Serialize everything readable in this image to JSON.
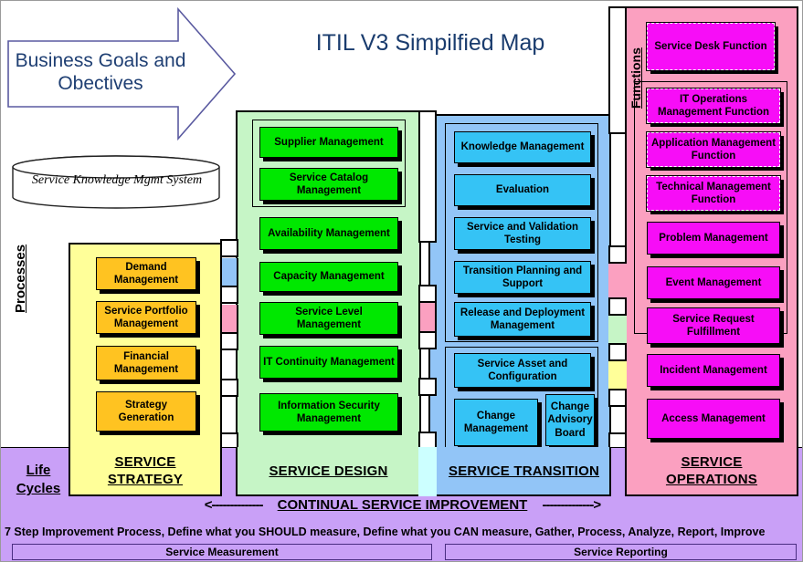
{
  "title": "ITIL V3 Simpilfied Map",
  "goals": {
    "text_line1": "Business Goals and",
    "text_line2": "Obectives",
    "icon": "right-arrow-banner"
  },
  "skms": {
    "label": "Service Knowledge Mgmt  System",
    "icon": "database-cylinder-icon"
  },
  "side_labels": {
    "processes": "Processes",
    "functions": "Functions",
    "life_cycles_line1": "Life ",
    "life_cycles_line2": "Cycles"
  },
  "columns": [
    {
      "key": "strategy",
      "title_line1": "SERVICE ",
      "title_line2": "STRATEGY",
      "color": "#ffff99",
      "box_color": "#ffc321",
      "items": [
        {
          "label": "Demand Management"
        },
        {
          "label": "Service Portfolio Management"
        },
        {
          "label": "Financial Management"
        },
        {
          "label": "Strategy Generation"
        }
      ]
    },
    {
      "key": "design",
      "title_line1": "SERVICE DESIGN",
      "title_line2": "",
      "color": "#c6f5c6",
      "box_color": "#00e800",
      "items": [
        {
          "label": "Supplier Management"
        },
        {
          "label": "Service Catalog Management"
        },
        {
          "label": "Availability Management"
        },
        {
          "label": "Capacity Management"
        },
        {
          "label": "Service Level Management"
        },
        {
          "label": "IT Continuity Management"
        },
        {
          "label": "Information Security Management"
        }
      ]
    },
    {
      "key": "transition",
      "title_line1": "SERVICE TRANSITION",
      "title_line2": "",
      "color": "#92c5f7",
      "box_color": "#35c3f5",
      "items": [
        {
          "label": "Knowledge Management"
        },
        {
          "label": "Evaluation"
        },
        {
          "label": "Service and Validation Testing"
        },
        {
          "label": "Transition Planning and Support"
        },
        {
          "label": "Release and Deployment Management"
        },
        {
          "label": "Service Asset and Configuration"
        },
        {
          "label": "Change Management"
        },
        {
          "label": "Change Advisory Board"
        }
      ]
    },
    {
      "key": "operations",
      "title_line1": "SERVICE ",
      "title_line2": "OPERATIONS",
      "color": "#fba0c0",
      "box_color": "#f70df7",
      "items": [
        {
          "label": "Service Desk Function"
        },
        {
          "label": "IT Operations Management Function"
        },
        {
          "label": "Application Management Function"
        },
        {
          "label": "Technical Management Function"
        },
        {
          "label": "Problem Management"
        },
        {
          "label": "Event Management"
        },
        {
          "label": "Service Request Fulfillment"
        },
        {
          "label": "Incident Management"
        },
        {
          "label": "Access Management"
        }
      ]
    }
  ],
  "csi": {
    "arrow_left": "<--------------",
    "title": "CONTINUAL SERVICE IMPROVEMENT",
    "arrow_right": "-------------->",
    "seven_step": "7 Step Improvement Process, Define what you SHOULD measure, Define what you CAN measure, Gather, Process, Analyze, Report, Improve",
    "service_measurement": "Service Measurement",
    "service_reporting": "Service Reporting"
  }
}
